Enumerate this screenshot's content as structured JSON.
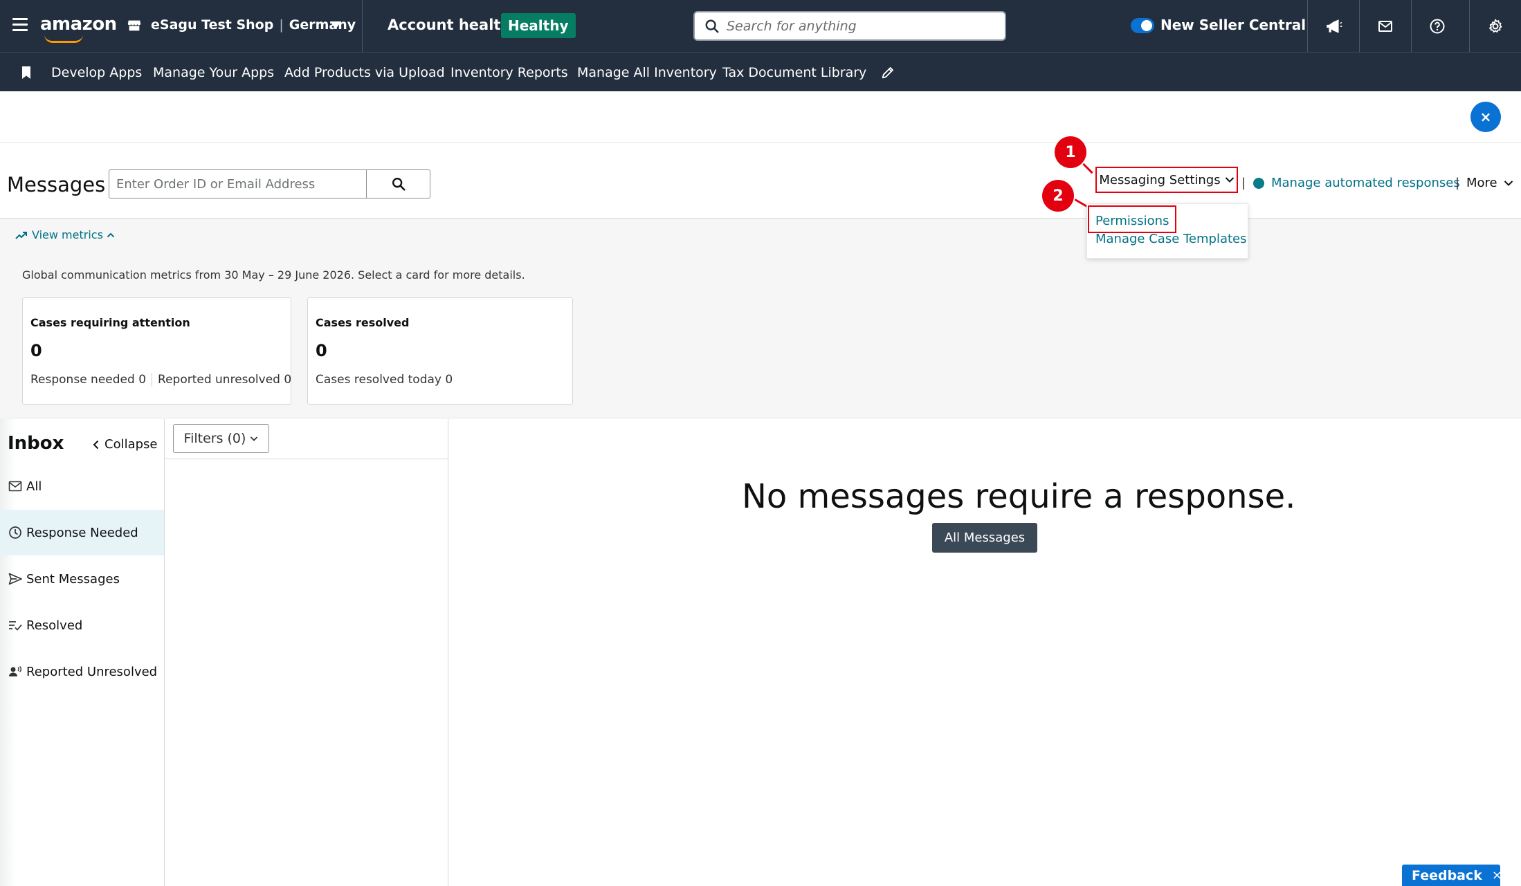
{
  "topbar": {
    "logo": "amazon",
    "store_name": "eSagu Test Shop",
    "marketplace": "Germany",
    "account_health_label": "Account health",
    "account_health_status": "Healthy",
    "search_placeholder": "Search for anything",
    "new_seller_central_label": "New Seller Central",
    "new_seller_central_on": true,
    "icons": [
      "menu-icon",
      "store-icon",
      "megaphone-icon",
      "mail-icon",
      "help-icon",
      "gear-icon"
    ]
  },
  "bookmarks": {
    "items": [
      {
        "label": "Develop Apps"
      },
      {
        "label": "Manage Your Apps"
      },
      {
        "label": "Add Products via Upload"
      },
      {
        "label": "Inventory Reports"
      },
      {
        "label": "Manage All Inventory"
      },
      {
        "label": "Tax Document Library"
      }
    ]
  },
  "banner": {
    "close_label": "×"
  },
  "messages": {
    "title": "Messages",
    "search_placeholder": "Enter Order ID or Email Address",
    "settings_label": "Messaging Settings",
    "separator": "|",
    "automated_label": "Manage automated responses",
    "more_label": "More",
    "dropdown": [
      {
        "label": "Permissions"
      },
      {
        "label": "Manage Case Templates"
      }
    ],
    "annotations": [
      "1",
      "2"
    ]
  },
  "metrics": {
    "toggle_label": "View metrics",
    "description": "Global communication metrics from 30 May – 29 June 2026. Select a card for more details.",
    "cards": [
      {
        "title": "Cases requiring attention",
        "value": "0",
        "sub1": "Response needed 0",
        "sub2": "Reported unresolved 0"
      },
      {
        "title": "Cases resolved",
        "value": "0",
        "sub1": "Cases resolved today 0"
      }
    ]
  },
  "inbox": {
    "title": "Inbox",
    "collapse_label": "Collapse",
    "items": [
      {
        "label": "All",
        "icon": "mail-icon"
      },
      {
        "label": "Response Needed",
        "icon": "clock-icon",
        "active": true
      },
      {
        "label": "Sent Messages",
        "icon": "send-icon"
      },
      {
        "label": "Resolved",
        "icon": "resolved-icon"
      },
      {
        "label": "Reported Unresolved",
        "icon": "reported-icon"
      }
    ],
    "filters_label": "Filters (0)"
  },
  "main": {
    "empty_title": "No messages require a response.",
    "all_messages_label": "All Messages"
  },
  "feedback": {
    "label": "Feedback",
    "close": "×"
  },
  "colors": {
    "nav_bg": "#232f3e",
    "healthy": "#067d62",
    "link": "#007185",
    "annotation_red": "#e3000f",
    "primary_blue": "#0972d3"
  }
}
